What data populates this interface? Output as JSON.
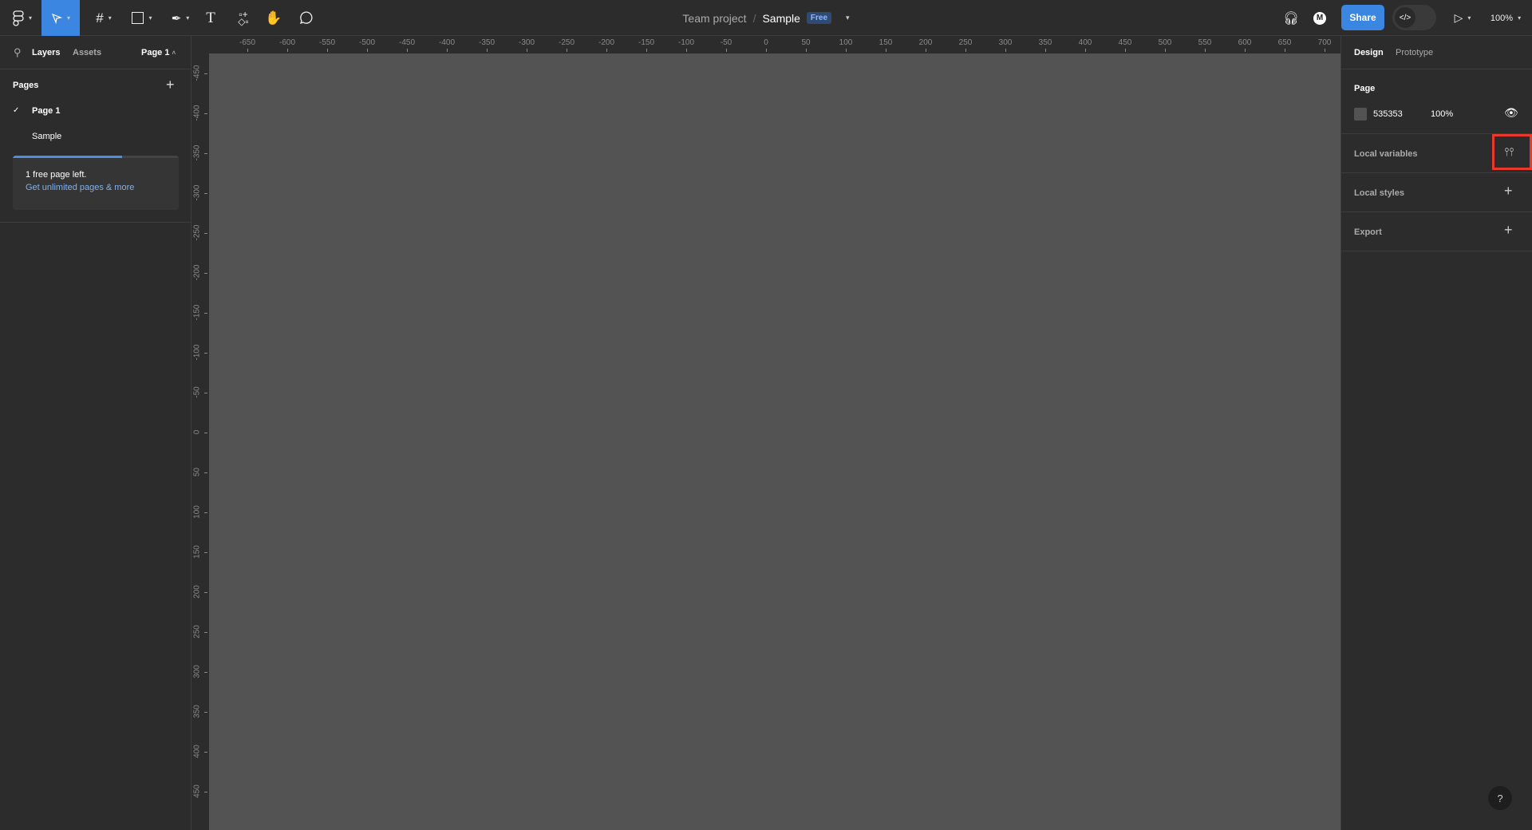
{
  "toolbar": {
    "tools": [
      "figma-menu",
      "move",
      "frame",
      "rectangle",
      "pen",
      "text",
      "actions",
      "hand",
      "comment"
    ],
    "active_tool": "move",
    "accent": "#3b86e0"
  },
  "title": {
    "project": "Team project",
    "separator": "/",
    "file": "Sample",
    "badge": "Free"
  },
  "topright": {
    "share": "Share",
    "zoom": "100%",
    "avatar_initial": "M"
  },
  "left": {
    "tabs": [
      "Layers",
      "Assets"
    ],
    "page_selector": "Page 1",
    "pages_title": "Pages",
    "pages": [
      {
        "label": "Page 1",
        "current": true
      },
      {
        "label": "Sample",
        "current": false
      }
    ],
    "page_usage_percent": 66,
    "notice": "1 free page left.",
    "upgrade_link": "Get unlimited pages & more"
  },
  "right": {
    "tabs": [
      "Design",
      "Prototype"
    ],
    "active_tab": "Design",
    "page_section": "Page",
    "fill_hex": "535353",
    "fill_color": "#535353",
    "fill_opacity": "100%",
    "sections": [
      "Local variables",
      "Local styles",
      "Export"
    ],
    "highlight_color": "#e8392b"
  },
  "rulers": {
    "horizontal": [
      "-650",
      "-600",
      "-550",
      "-500",
      "-450",
      "-400",
      "-350",
      "-300",
      "-250",
      "-200",
      "-150",
      "-100",
      "-50",
      "0",
      "50",
      "100",
      "150",
      "200",
      "250",
      "300",
      "350",
      "400",
      "450",
      "500",
      "550",
      "600",
      "650",
      "700"
    ],
    "vertical": [
      "-450",
      "-400",
      "-350",
      "-300",
      "-250",
      "-200",
      "-150",
      "-100",
      "-50",
      "0",
      "50",
      "100",
      "150",
      "200",
      "250",
      "300",
      "350",
      "400",
      "450"
    ]
  },
  "help": "?"
}
